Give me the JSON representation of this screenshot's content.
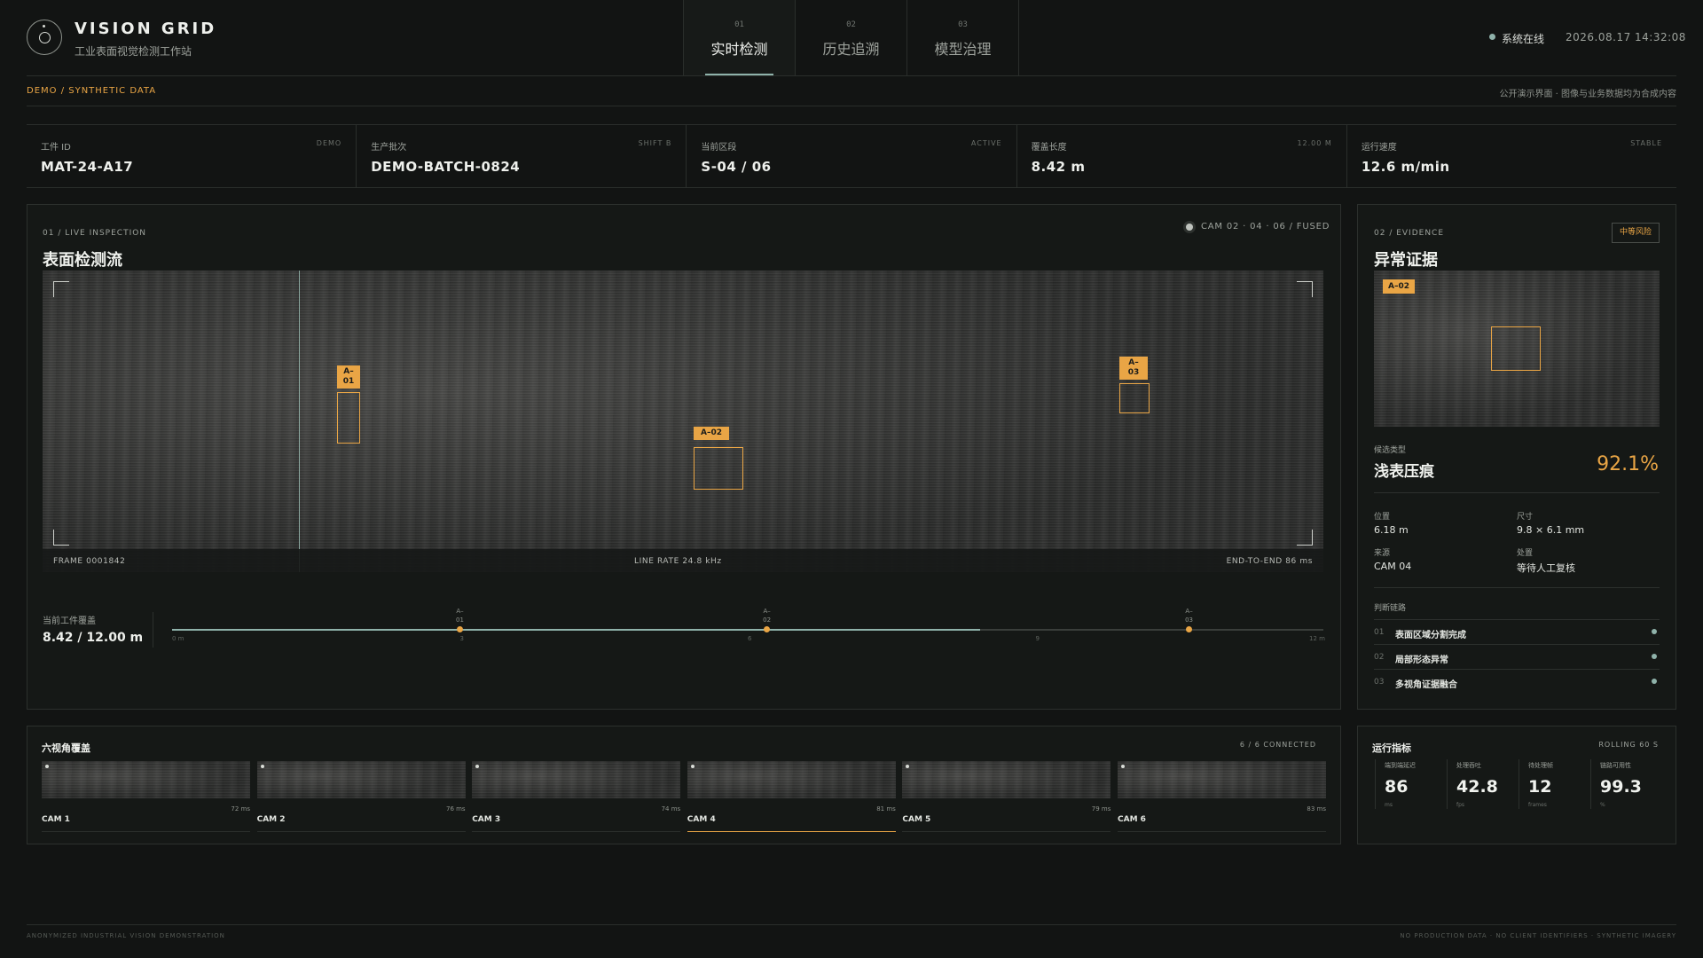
{
  "brand": {
    "title": "VISION GRID",
    "subtitle": "工业表面视觉检测工作站"
  },
  "nav": {
    "tabs": [
      {
        "num": "01",
        "label": "实时检测"
      },
      {
        "num": "02",
        "label": "历史追溯"
      },
      {
        "num": "03",
        "label": "模型治理"
      }
    ]
  },
  "status": {
    "text": "系统在线",
    "datetime": "2026.08.17  14:32:08"
  },
  "demo_tag": "DEMO / SYNTHETIC DATA",
  "notice": "公开演示界面 · 图像与业务数据均为合成内容",
  "info": [
    {
      "label": "工件 ID",
      "tag": "DEMO",
      "value": "MAT-24-A17"
    },
    {
      "label": "生产批次",
      "tag": "SHIFT B",
      "value": "DEMO-BATCH-0824"
    },
    {
      "label": "当前区段",
      "tag": "ACTIVE",
      "value": "S-04 / 06"
    },
    {
      "label": "覆盖长度",
      "tag": "12.00 M",
      "value": "8.42 m"
    },
    {
      "label": "运行速度",
      "tag": "STABLE",
      "value": "12.6 m/min"
    }
  ],
  "live": {
    "section": "01 / LIVE INSPECTION",
    "title": "表面检测流",
    "cam": "CAM 02 · 04 · 06 / FUSED",
    "frame": "FRAME 0001842",
    "line_rate": "LINE RATE 24.8 kHz",
    "end_to_end": "END-TO-END 86 ms",
    "detections": [
      {
        "id": "A-01",
        "label": "A–\n01"
      },
      {
        "id": "A-02",
        "label": "A–02"
      },
      {
        "id": "A-03",
        "label": "A–\n03"
      }
    ],
    "coverage_label": "当前工件覆盖",
    "coverage_value": "8.42 / 12.00 m",
    "coverage_fraction": 0.7017,
    "markers": [
      {
        "label": "A–\n01",
        "pos_m": 3.0
      },
      {
        "label": "A–\n02",
        "pos_m": 6.2
      },
      {
        "label": "A–\n03",
        "pos_m": 10.6
      }
    ],
    "ticks": [
      "0 m",
      "3",
      "6",
      "9",
      "12 m"
    ]
  },
  "evidence": {
    "section": "02 / EVIDENCE",
    "title": "异常证据",
    "risk": "中等风险",
    "tag": "A–02",
    "candidate_label": "候选类型",
    "candidate_value": "浅表压痕",
    "confidence": "92.1%",
    "fields": [
      {
        "label": "位置",
        "value": "6.18 m"
      },
      {
        "label": "尺寸",
        "value": "9.8 × 6.1 mm"
      },
      {
        "label": "来源",
        "value": "CAM 04"
      },
      {
        "label": "处置",
        "value": "等待人工复核"
      }
    ],
    "chain_label": "判断链路",
    "chain": [
      {
        "num": "01",
        "text": "表面区域分割完成"
      },
      {
        "num": "02",
        "text": "局部形态异常"
      },
      {
        "num": "03",
        "text": "多视角证据融合"
      }
    ]
  },
  "cameras": {
    "title": "六视角覆盖",
    "connected": "6 / 6 CONNECTED",
    "items": [
      {
        "name": "CAM 1",
        "latency": "72 ms"
      },
      {
        "name": "CAM 2",
        "latency": "76 ms"
      },
      {
        "name": "CAM 3",
        "latency": "74 ms"
      },
      {
        "name": "CAM 4",
        "latency": "81 ms"
      },
      {
        "name": "CAM 5",
        "latency": "79 ms"
      },
      {
        "name": "CAM 6",
        "latency": "83 ms"
      }
    ]
  },
  "metrics": {
    "title": "运行指标",
    "rolling": "ROLLING 60 S",
    "items": [
      {
        "label": "端到端延迟",
        "value": "86",
        "unit": "ms"
      },
      {
        "label": "处理吞吐",
        "value": "42.8",
        "unit": "fps"
      },
      {
        "label": "待处理帧",
        "value": "12",
        "unit": "frames"
      },
      {
        "label": "链路可用性",
        "value": "99.3",
        "unit": "%"
      }
    ]
  },
  "footer": {
    "left": "ANONYMIZED INDUSTRIAL VISION DEMONSTRATION",
    "right": "NO PRODUCTION DATA · NO CLIENT IDENTIFIERS · SYNTHETIC IMAGERY"
  },
  "colors": {
    "accent": "#e9a545",
    "teal": "#8fb2aa",
    "background": "#121413"
  }
}
